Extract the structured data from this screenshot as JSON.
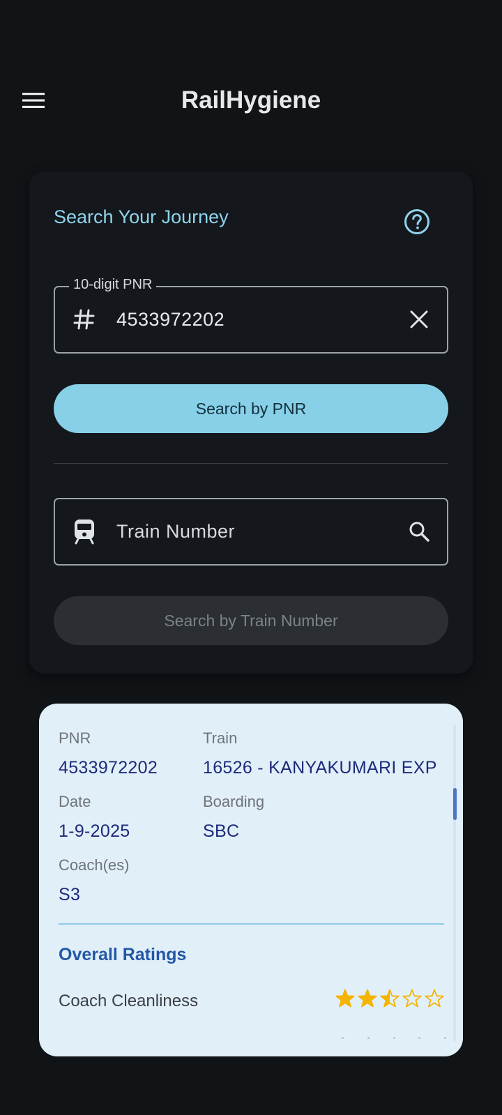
{
  "app": {
    "title": "RailHygiene",
    "menu_icon": "menu-icon"
  },
  "search": {
    "heading": "Search Your Journey",
    "help_icon": "help-circle-icon",
    "pnr_field": {
      "label": "10-digit PNR",
      "value": "4533972202",
      "lead_icon": "hash-icon",
      "trail_icon": "clear-icon"
    },
    "pnr_button": "Search by PNR",
    "train_field": {
      "placeholder": "Train Number",
      "lead_icon": "train-icon",
      "trail_icon": "search-icon"
    },
    "train_button": "Search by Train Number"
  },
  "result": {
    "pnr_label": "PNR",
    "pnr_value": "4533972202",
    "train_label": "Train",
    "train_value": "16526 - KANYAKUMARI EXP",
    "date_label": "Date",
    "date_value": "1-9-2025",
    "boarding_label": "Boarding",
    "boarding_value": "SBC",
    "coach_label": "Coach(es)",
    "coach_value": "S3",
    "ratings_heading": "Overall Ratings",
    "ratings": [
      {
        "label": "Coach Cleanliness",
        "stars": 2.5,
        "max": 5
      }
    ]
  },
  "colors": {
    "background": "#101417",
    "accent": "#87d0e8",
    "heading": "#8fd3ec",
    "result_bg": "#e1eff9",
    "result_value": "#1e2a7a",
    "ratings_heading": "#2358a8",
    "star": "#f5b400"
  }
}
